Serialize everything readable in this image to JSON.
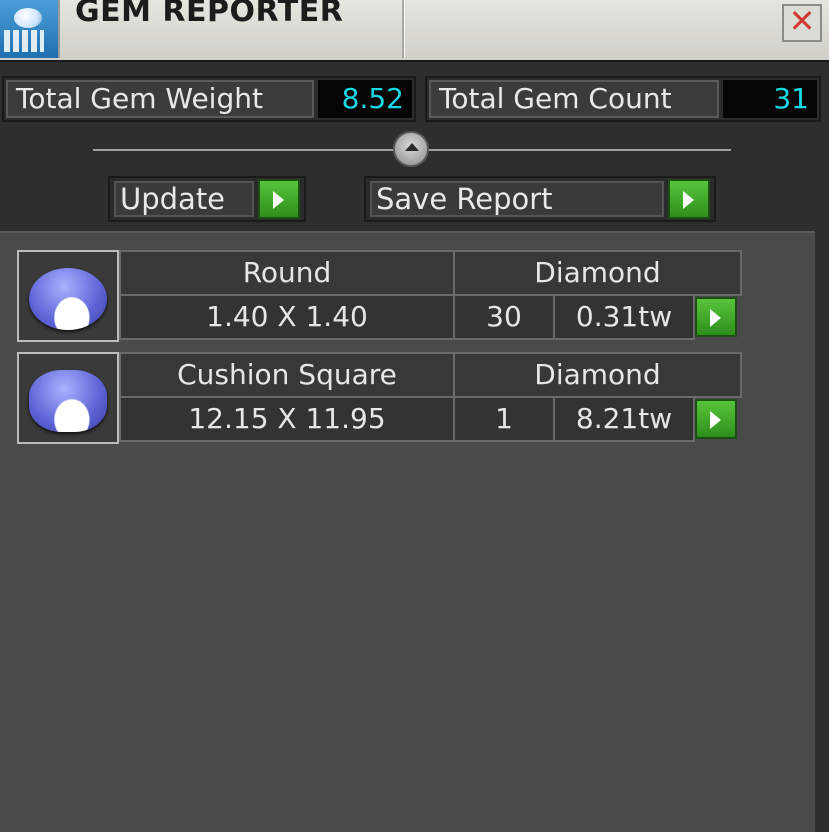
{
  "window": {
    "title": "GEM REPORTER",
    "close_glyph": "✕",
    "icon": "gem-reporter-app-icon"
  },
  "stats": {
    "weight_label": "Total Gem Weight",
    "weight_value": "8.52",
    "count_label": "Total Gem Count",
    "count_value": "31",
    "value_color": "#19d8e6"
  },
  "actions": {
    "update_label": "Update",
    "save_label": "Save Report",
    "go_icon": "play-arrow-icon",
    "go_color": "#3aa826"
  },
  "gems": [
    {
      "shape": "Round",
      "material": "Diamond",
      "size": "1.40 X 1.40",
      "count": "30",
      "weight": "0.31tw",
      "thumb_icon": "round-gem-icon"
    },
    {
      "shape": "Cushion Square",
      "material": "Diamond",
      "size": "12.15 X 11.95",
      "count": "1",
      "weight": "8.21tw",
      "thumb_icon": "cushion-gem-icon"
    }
  ]
}
